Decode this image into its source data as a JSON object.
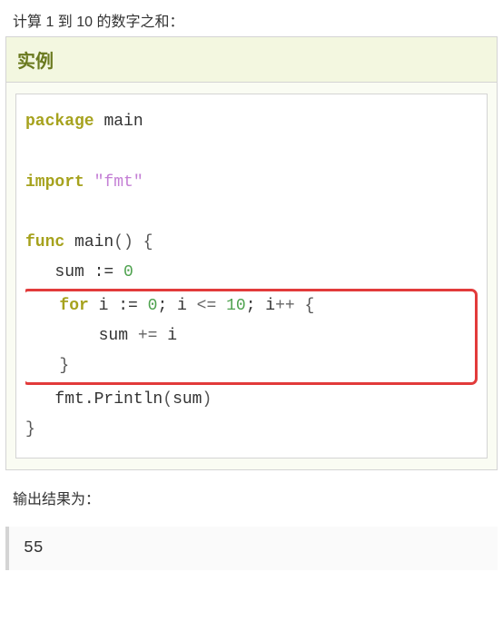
{
  "intro": "计算 1 到 10 的数字之和：",
  "exampleTitle": "实例",
  "code": {
    "kw_package": "package",
    "pkg_name": "main",
    "kw_import": "import",
    "import_str": "\"fmt\"",
    "kw_func": "func",
    "func_name": "main",
    "open_paren": "()",
    "open_brace": "{",
    "indent1_sum": "   sum ",
    "decl": ":=",
    "sp": " ",
    "zero": "0",
    "kw_for": "for",
    "i_decl": " i ",
    "semi1": "; i ",
    "lte": "<=",
    "ten": "10",
    "semi2": "; i",
    "inc": "++",
    "open_brace2": " {",
    "sum_line": "       sum ",
    "pluseq": "+=",
    "i2": " i",
    "close_brace2": "   }",
    "fmt_line": "   fmt",
    "dot": ".",
    "println": "Println",
    "open_p2": "(",
    "sum_arg": "sum",
    "close_p2": ")",
    "close_brace": "}"
  },
  "outputLabel": "输出结果为：",
  "output": "55"
}
